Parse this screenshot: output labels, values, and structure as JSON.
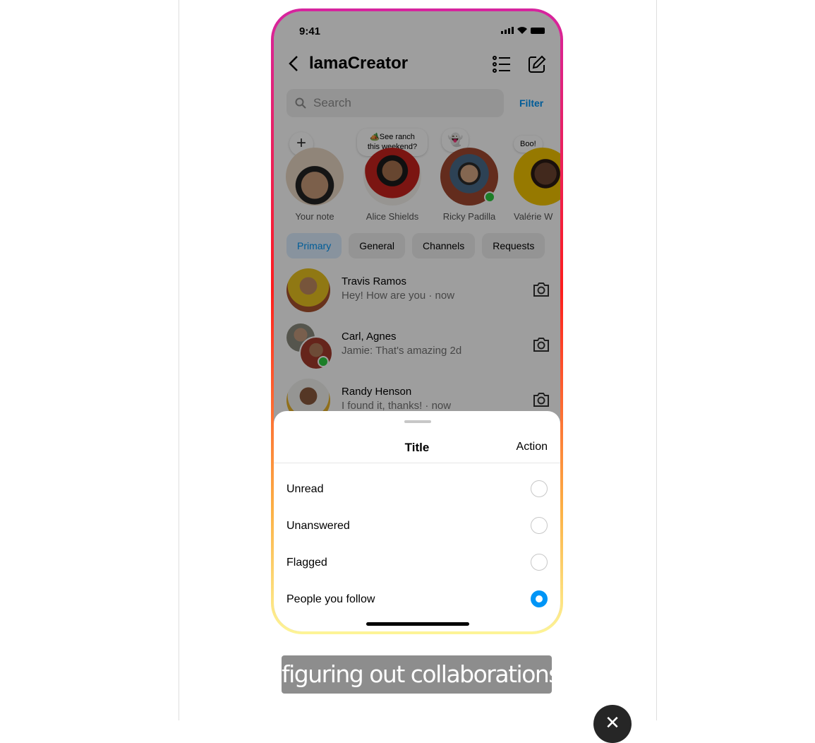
{
  "status": {
    "time": "9:41"
  },
  "header": {
    "title": "lamaCreator"
  },
  "search": {
    "placeholder": "Search",
    "filter_label": "Filter"
  },
  "stories": [
    {
      "name": "Your note",
      "note": ""
    },
    {
      "name": "Alice Shields",
      "note": "🏕️See ranch this weekend?"
    },
    {
      "name": "Ricky Padilla",
      "note": "👻"
    },
    {
      "name": "Valérie W",
      "note": "Boo!"
    }
  ],
  "tabs": [
    "Primary",
    "General",
    "Channels",
    "Requests"
  ],
  "messages": [
    {
      "name": "Travis Ramos",
      "preview": "Hey! How are you · now"
    },
    {
      "name": "Carl, Agnes",
      "preview": "Jamie: That's amazing 2d"
    },
    {
      "name": "Randy Henson",
      "preview": "I found it, thanks! · now"
    }
  ],
  "sheet": {
    "title": "Title",
    "action": "Action",
    "options": [
      {
        "label": "Unread",
        "selected": false
      },
      {
        "label": "Unanswered",
        "selected": false
      },
      {
        "label": "Flagged",
        "selected": false
      },
      {
        "label": "People you follow",
        "selected": true
      }
    ]
  },
  "caption": "figuring out collaborations,",
  "colors": {
    "accent": "#0095f6",
    "gradient_top": "#d6249f",
    "gradient_bottom": "#fdf497"
  }
}
